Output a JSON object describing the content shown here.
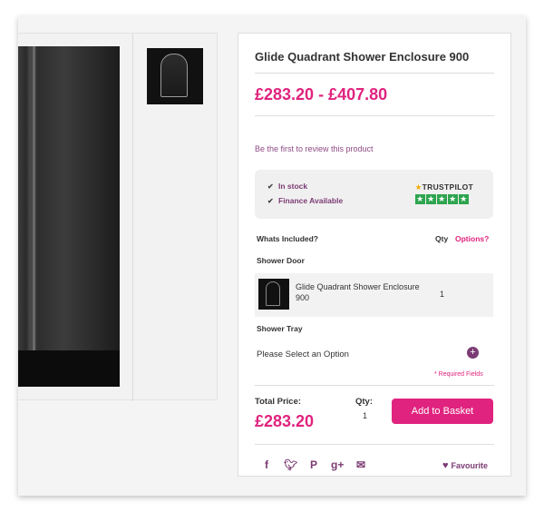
{
  "product": {
    "title": "Glide Quadrant Shower Enclosure 900",
    "price_range": "£283.20 - £407.80",
    "review_link": "Be the first to review this product"
  },
  "stock": {
    "in_stock": "In stock",
    "finance": "Finance Available",
    "trustpilot_label": "TRUSTPILOT",
    "trustpilot_stars": 5
  },
  "included": {
    "heading": "Whats Included?",
    "qty_heading": "Qty",
    "options_link": "Options?",
    "door": {
      "label": "Shower Door",
      "item_name": "Glide Quadrant Shower Enclosure 900",
      "qty": "1"
    },
    "tray": {
      "label": "Shower Tray",
      "placeholder": "Please Select an Option"
    },
    "required_note": "* Required Fields"
  },
  "purchase": {
    "total_label": "Total Price:",
    "total_price": "£283.20",
    "qty_label": "Qty:",
    "qty_value": "1",
    "basket_button": "Add to Basket"
  },
  "social": {
    "icons": [
      "facebook-icon",
      "twitter-icon",
      "pinterest-icon",
      "google-plus-icon",
      "email-icon"
    ],
    "favourite": "Favourite"
  },
  "colors": {
    "accent_pink": "#e0237e",
    "accent_purple": "#7b3b73"
  }
}
